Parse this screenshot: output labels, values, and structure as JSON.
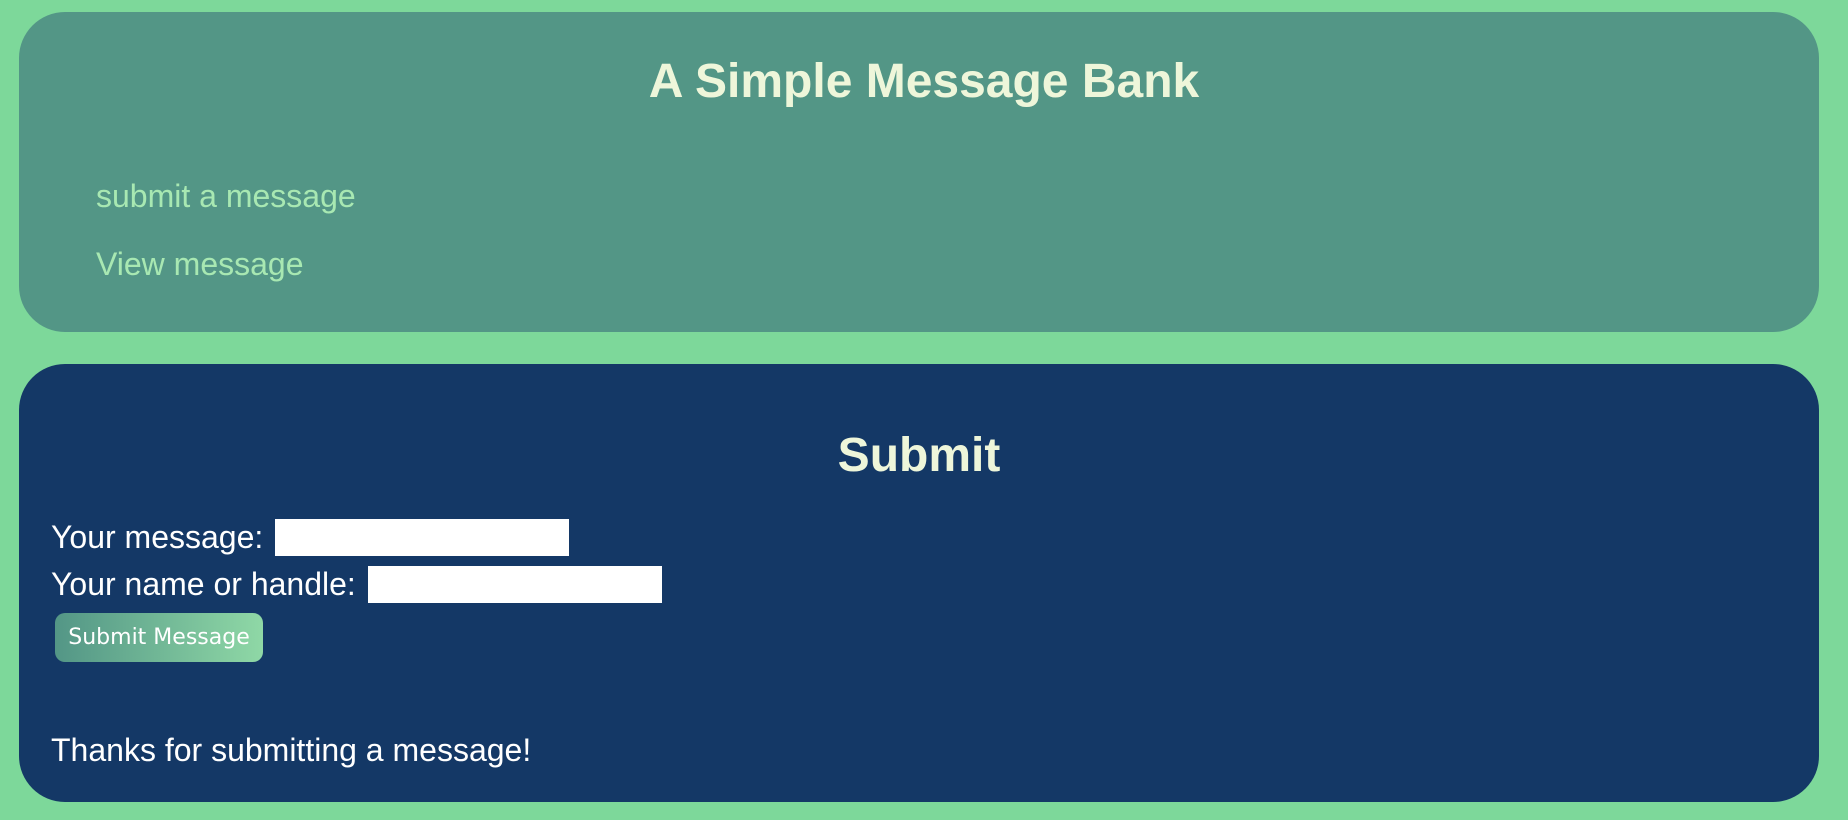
{
  "header": {
    "title": "A Simple Message Bank",
    "nav": [
      {
        "label": "submit a message"
      },
      {
        "label": "View message"
      }
    ]
  },
  "submit_section": {
    "title": "Submit",
    "message_label": "Your message:",
    "message_value": "",
    "name_label": "Your name or handle:",
    "name_value": "",
    "button_label": "Submit Message",
    "status": "Thanks for submitting a message!"
  },
  "colors": {
    "page_background": "#7dd89a",
    "header_panel": "#539686",
    "submit_panel": "#143866",
    "title_text": "#eef6da",
    "nav_link": "#a8e8b2"
  }
}
